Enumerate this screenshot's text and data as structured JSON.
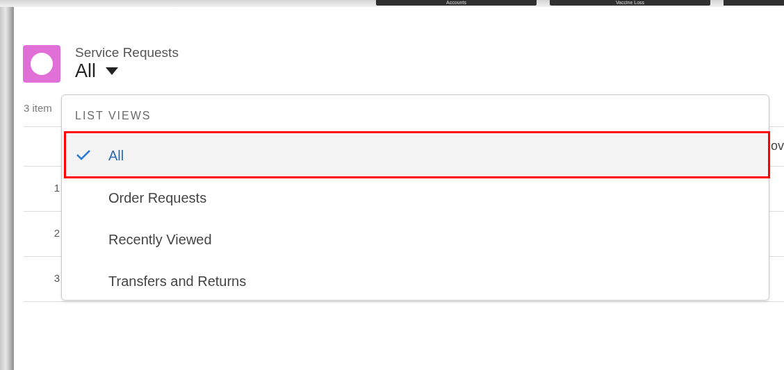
{
  "background_tabs": [
    {
      "label": "Accounts"
    },
    {
      "label": "Vaccine Loss"
    },
    {
      "cut_off": true
    }
  ],
  "header": {
    "object_label": "Service Requests",
    "list_view": "All"
  },
  "item_count": "3 item",
  "table": {
    "column_cut": "ov",
    "row_numbers": [
      "1",
      "2",
      "3"
    ]
  },
  "dropdown": {
    "heading": "LIST VIEWS",
    "items": [
      {
        "label": "All",
        "selected": true,
        "highlighted": true
      },
      {
        "label": "Order Requests",
        "selected": false,
        "highlighted": false
      },
      {
        "label": "Recently Viewed",
        "selected": false,
        "highlighted": false
      },
      {
        "label": "Transfers and Returns",
        "selected": false,
        "highlighted": false
      }
    ]
  }
}
